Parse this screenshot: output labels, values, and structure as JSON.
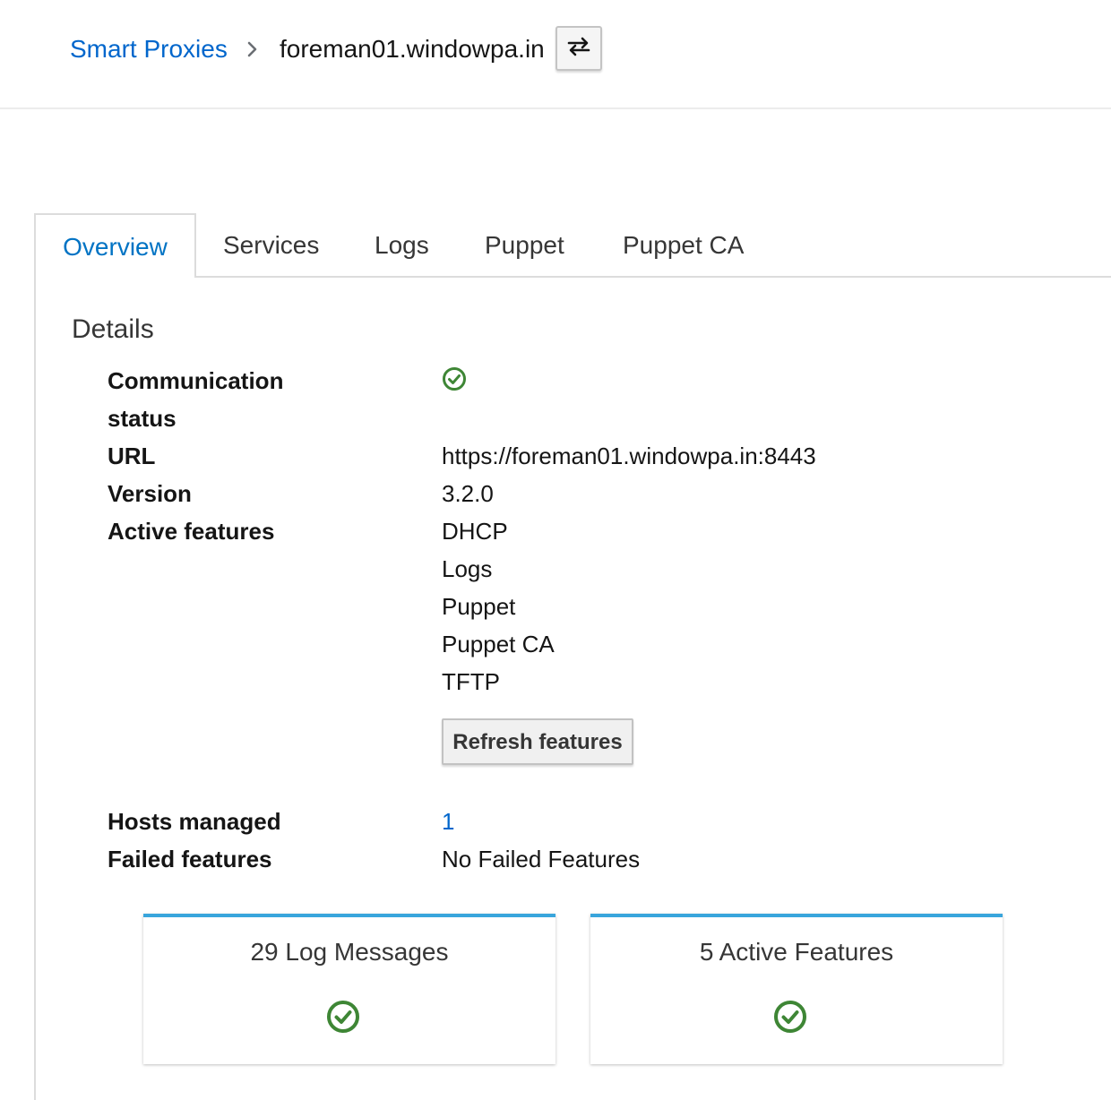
{
  "breadcrumb": {
    "parent": "Smart Proxies",
    "current": "foreman01.windowpa.in"
  },
  "tabs": [
    {
      "label": "Overview",
      "active": true
    },
    {
      "label": "Services",
      "active": false
    },
    {
      "label": "Logs",
      "active": false
    },
    {
      "label": "Puppet",
      "active": false
    },
    {
      "label": "Puppet CA",
      "active": false
    }
  ],
  "details": {
    "title": "Details",
    "communication_status_label_line1": "Communication",
    "communication_status_label_line2": "status",
    "url_label": "URL",
    "url_value": "https://foreman01.windowpa.in:8443",
    "version_label": "Version",
    "version_value": "3.2.0",
    "active_features_label": "Active features",
    "active_features": [
      "DHCP",
      "Logs",
      "Puppet",
      "Puppet CA",
      "TFTP"
    ],
    "refresh_button_label": "Refresh features",
    "hosts_managed_label": "Hosts managed",
    "hosts_managed_value": "1",
    "failed_features_label": "Failed features",
    "failed_features_value": "No Failed Features"
  },
  "cards": [
    {
      "title": "29 Log Messages"
    },
    {
      "title": "5 Active Features"
    }
  ],
  "colors": {
    "link": "#0066cc",
    "success": "#3e8635",
    "card_accent": "#39a5dc"
  },
  "icons": {
    "switcher": "switch-arrows-icon",
    "breadcrumb_separator": "chevron-right-icon",
    "status": "check-circle-icon"
  }
}
